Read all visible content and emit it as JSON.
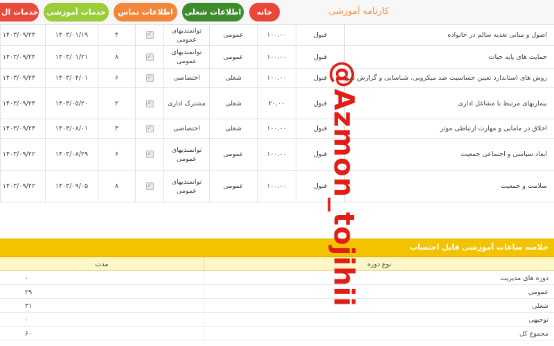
{
  "header": {
    "brand": "کارنامه آموزشی",
    "nav": {
      "home": "خانه",
      "job_info": "اطلاعات شغلی",
      "contact_info": "اطلاعات تماس",
      "edu_services": "خدمات آموزشی",
      "services": "خدمات ال"
    }
  },
  "courses": [
    {
      "title": "اصول و مبانی تغذیه سالم در خانواده",
      "status": "قبول",
      "hours": "۱۰۰.۰۰",
      "type": "عمومی",
      "category": "توانمندیهای عمومی",
      "num": "۴",
      "date": "۱۴۰۳/۰۱/۱۹",
      "end_date": "۱۴۰۳/۰۹/۲۴",
      "checked": true
    },
    {
      "title": "حمایت های پایه حیات",
      "status": "قبول",
      "hours": "۱۰۰.۰۰",
      "type": "عمومی",
      "category": "توانمندیهای عمومی",
      "num": "۸",
      "date": "۱۴۰۳/۰۱/۲۱",
      "end_date": "۱۴۰۳/۰۹/۲۴",
      "checked": true
    },
    {
      "title": "روش های استاندارد تعیین حساسیت ضد میکروبی، شناسایی و گزارش سویه های",
      "status": "قبول",
      "hours": "۱۰۰.۰۰",
      "type": "شغلی",
      "category": "اختصاصی",
      "num": "۶",
      "date": "۱۴۰۳/۰۴/۰۱",
      "end_date": "۱۴۰۳/۰۹/۲۴",
      "checked": true
    },
    {
      "title": "بیماریهای مرتبط با مشاغل اداری",
      "status": "قبول",
      "hours": "۲۰.۰۰",
      "type": "شغلی",
      "category": "مشترک اداری",
      "num": "۲",
      "date": "۱۴۰۳/۰۵/۲۰",
      "end_date": "۱۴۰۳/۰۹/۲۴",
      "checked": true
    },
    {
      "title": "اخلاق در مامایی و مهارت ارتباطی موثر",
      "status": "قبول",
      "hours": "۱۰۰.۰۰",
      "type": "شغلی",
      "category": "اختصاصی",
      "num": "۳",
      "date": "۱۴۰۳/۰۸/۰۱",
      "end_date": "۱۴۰۳/۰۹/۲۴",
      "checked": true
    },
    {
      "title": "ابعاد سیاسی و اجتماعی جمعیت",
      "status": "قبول",
      "hours": "۱۰۰.۰۰",
      "type": "عمومی",
      "category": "توانمندیهای عمومی",
      "num": "۶",
      "date": "۱۴۰۳/۰۸/۲۹",
      "end_date": "۱۴۰۳/۰۹/۲۲",
      "checked": true
    },
    {
      "title": "سلامت و جمعیت",
      "status": "قبول",
      "hours": "۱۰۰.۰۰",
      "type": "عمومی",
      "category": "توانمندیهای عمومی",
      "num": "۸",
      "date": "۱۴۰۳/۰۹/۰۵",
      "end_date": "۱۴۰۳/۰۹/۲۲",
      "checked": true
    }
  ],
  "summary": {
    "title": "خلاصه ساعات آموزشی قابل احتساب",
    "col_type": "نوع دوره",
    "col_duration": "مدت",
    "rows": [
      {
        "label": "دوره های مدیریت",
        "value": "۰"
      },
      {
        "label": "عمومی",
        "value": "۲۹"
      },
      {
        "label": "شغلی",
        "value": "۳۱"
      },
      {
        "label": "توجیهی",
        "value": "۰"
      },
      {
        "label": "مجموع کل",
        "value": "۶۰"
      }
    ]
  },
  "watermark": "@Azmon_tojihii"
}
